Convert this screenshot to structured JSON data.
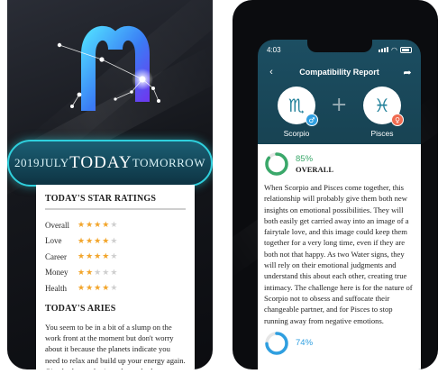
{
  "left_screen": {
    "date_strip": {
      "prev_year": "2019",
      "prev": "JULY",
      "current": "TODAY",
      "next": "TOMORROW"
    },
    "ratings_title": "TODAY'S STAR RATINGS",
    "ratings": [
      {
        "label": "Overall",
        "stars": 4,
        "max": 5
      },
      {
        "label": "Love",
        "stars": 4,
        "max": 5
      },
      {
        "label": "Career",
        "stars": 4,
        "max": 5
      },
      {
        "label": "Money",
        "stars": 2,
        "max": 5
      },
      {
        "label": "Health",
        "stars": 4,
        "max": 5
      }
    ],
    "section_title": "TODAY'S ARIES",
    "body": "You seem to be in a bit of a slump on the work front at the moment but don't worry about it because the planets indicate you need to relax and build up your energy again. Give both your brain and your body a"
  },
  "right_screen": {
    "status": {
      "time": "4:03"
    },
    "nav": {
      "back_icon": "chevron-left-icon",
      "title": "Compatibility Report",
      "share_icon": "share-icon"
    },
    "signs": [
      {
        "name": "Scorpio",
        "glyph": "♏",
        "gender_glyph": "♂",
        "gender": "male"
      },
      {
        "name": "Pisces",
        "glyph": "♓",
        "gender_glyph": "♀",
        "gender": "female"
      }
    ],
    "plus": "+",
    "overall": {
      "percent_text": "85%",
      "percent": 85,
      "label": "OVERALL"
    },
    "body": "When Scorpio and Pisces come together, this relationship will probably give them both new insights on emotional possibilities. They will both easily get carried away into an image of a fairytale love, and this image could keep them together for a very long time, even if they are both not that happy. As two Water signs, they will rely on their emotional judgments and understand this about each other, creating true intimacy. The challenge here is for the nature of Scorpio not to obsess and suffocate their changeable partner, and for Pisces to stop running away from negative emotions.",
    "second": {
      "percent_text": "74%",
      "percent": 74
    }
  },
  "colors": {
    "accent_cyan": "#2fd0dd",
    "star_on": "#f2a52b",
    "star_off": "#cfcfcf",
    "ring_green": "#3aa86a",
    "ring_blue": "#2f9fe0",
    "header_teal": "#1c4e62"
  }
}
